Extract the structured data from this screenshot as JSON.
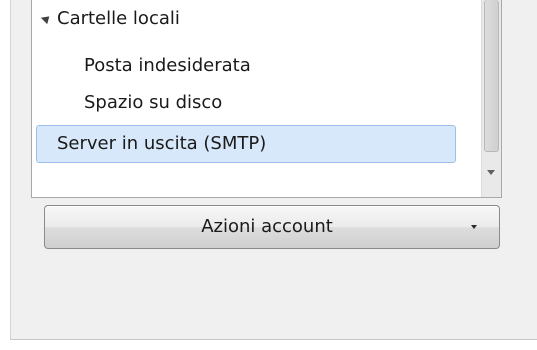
{
  "tree": {
    "items": [
      {
        "label": "Cartelle locali",
        "expanded": true
      },
      {
        "label": "Posta indesiderata"
      },
      {
        "label": "Spazio su disco"
      },
      {
        "label": "Server in uscita (SMTP)",
        "selected": true
      }
    ]
  },
  "actions": {
    "account_button_label": "Azioni account"
  },
  "icons": {
    "expander": "triangle-expanded-icon",
    "scroll_down": "scroll-down-arrow-icon",
    "dropdown": "chevron-down-icon"
  },
  "colors": {
    "selection_bg": "#d8e8fb",
    "selection_border": "#9cc0ea",
    "panel_bg": "#f0f0f0"
  }
}
